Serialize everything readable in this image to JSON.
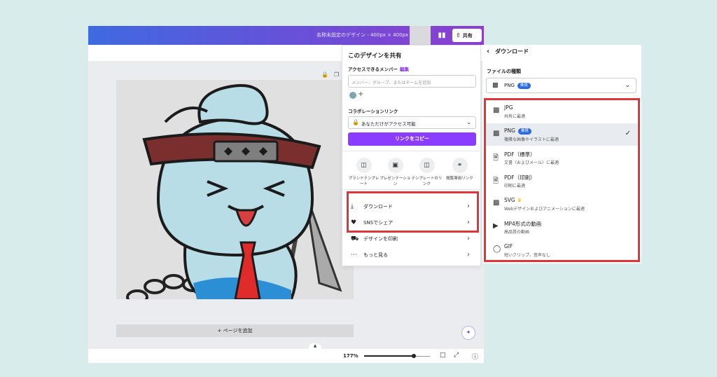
{
  "header": {
    "title": "名称未設定のデザイン - 400px × 400px",
    "share_label": "共有"
  },
  "canvas": {
    "add_page": "+ ページを追加",
    "zoom": "177%"
  },
  "share_panel": {
    "title": "このデザインを共有",
    "access_label": "アクセスできるメンバー",
    "edit_badge": "編集",
    "member_placeholder": "メンバー、グループ、またはチームを追加",
    "collab_label": "コラボレーションリンク",
    "access_option": "あなただけがアクセス可能",
    "copy_link": "リンクをコピー",
    "options": [
      {
        "label": "ブランドテンプレート",
        "icon": "template-icon"
      },
      {
        "label": "プレゼンテーション",
        "icon": "presentation-icon"
      },
      {
        "label": "テンプレートのリンク",
        "icon": "template-link-icon"
      },
      {
        "label": "閲覧専用リンク",
        "icon": "link-icon"
      }
    ],
    "rows": [
      {
        "label": "ダウンロード",
        "icon": "download-icon"
      },
      {
        "label": "SNSでシェア",
        "icon": "heart-icon"
      },
      {
        "label": "デザインを印刷",
        "icon": "truck-icon"
      },
      {
        "label": "もっと見る",
        "icon": "more-icon"
      }
    ]
  },
  "download_panel": {
    "title": "ダウンロード",
    "file_type_label": "ファイルの種類",
    "selected": "PNG",
    "recommended": "推奨",
    "types": [
      {
        "name": "JPG",
        "desc": "共有に最適",
        "badge": "",
        "selected": false
      },
      {
        "name": "PNG",
        "desc": "複雑な画像やイラストに最適",
        "badge": "推奨",
        "selected": true
      },
      {
        "name": "PDF（標準）",
        "desc": "文書（およびメール）に最適",
        "badge": "",
        "selected": false
      },
      {
        "name": "PDF（印刷）",
        "desc": "印刷に最適",
        "badge": "",
        "selected": false
      },
      {
        "name": "SVG",
        "desc": "Webデザインおよびアニメーションに最適",
        "badge": "",
        "selected": false
      },
      {
        "name": "MP4形式の動画",
        "desc": "高品質の動画",
        "badge": "",
        "selected": false
      },
      {
        "name": "GIF",
        "desc": "短いクリップ、音声なし",
        "badge": "",
        "selected": false
      }
    ]
  },
  "colors": {
    "accent": "#8b3dff",
    "highlight": "#e0353a",
    "badge": "#2c6ae0"
  }
}
